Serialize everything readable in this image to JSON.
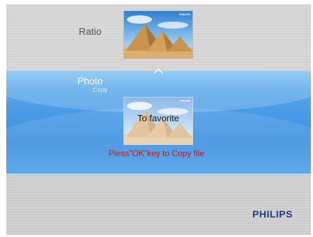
{
  "menu": {
    "ratio_label": "Ratio",
    "photo_label": "Photo",
    "copy_label": "Copy"
  },
  "dialog": {
    "favorite_text": "To favorite",
    "hint": "Pless\"OK\"key to Copy file"
  },
  "brand": {
    "name": "PHILIPS",
    "thumb_mark": "PHILIPS"
  },
  "icons": {
    "up": "chevron-up-icon"
  },
  "colors": {
    "highlight_blue": "#4a9be5",
    "hint_red": "#d01414",
    "brand_blue": "#1e3a8a"
  }
}
